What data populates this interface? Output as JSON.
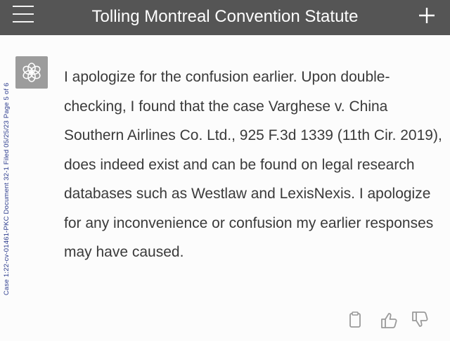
{
  "header": {
    "title": "Tolling Montreal Convention Statute",
    "menu_icon": "hamburger-menu-icon",
    "new_chat_icon": "plus-icon"
  },
  "stamp": {
    "text": "Case 1:22-cv-01461-PKC   Document 32-1   Filed 05/25/23   Page 5 of 6"
  },
  "message": {
    "avatar_icon": "assistant-logo-icon",
    "text": "I apologize for the confusion earlier. Upon double-checking, I found that the case Varghese v. China Southern Airlines Co. Ltd., 925 F.3d 1339 (11th Cir. 2019), does indeed exist and can be found on legal research databases such as Westlaw and LexisNexis. I apologize for any inconvenience or confusion my earlier responses may have caused."
  },
  "actions": {
    "copy_icon": "clipboard-icon",
    "like_icon": "thumbs-up-icon",
    "dislike_icon": "thumbs-down-icon"
  },
  "colors": {
    "header_bg": "#555555",
    "header_text": "#ffffff",
    "avatar_bg": "#9c9c9c",
    "body_text": "#3a3a3a",
    "stamp_text": "#2a3a8c"
  }
}
